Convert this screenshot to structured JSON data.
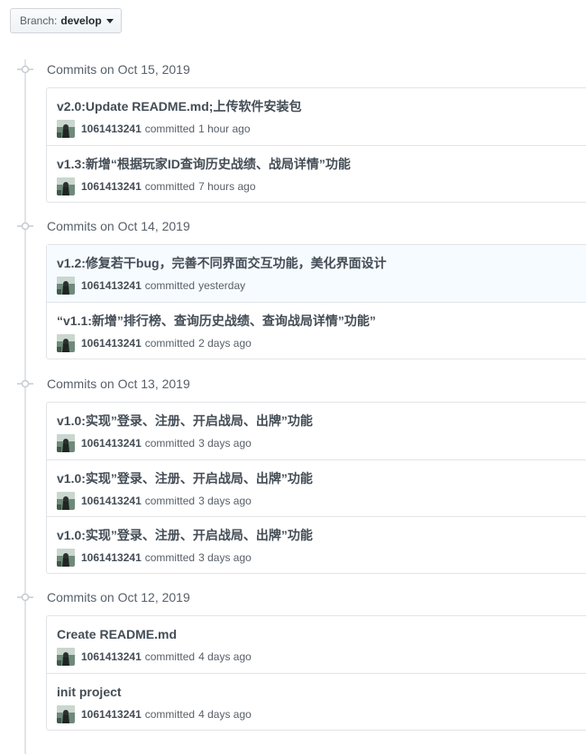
{
  "branch": {
    "prefix": "Branch:",
    "name": "develop"
  },
  "groups": [
    {
      "title": "Commits on Oct 15, 2019",
      "commits": [
        {
          "message": "v2.0:Update README.md;上传软件安装包",
          "author": "1061413241",
          "verb": "committed",
          "time": "1 hour ago"
        },
        {
          "message": "v1.3:新增“根据玩家ID查询历史战绩、战局详情”功能",
          "author": "1061413241",
          "verb": "committed",
          "time": "7 hours ago"
        }
      ]
    },
    {
      "title": "Commits on Oct 14, 2019",
      "commits": [
        {
          "message": "v1.2:修复若干bug，完善不同界面交互功能，美化界面设计",
          "author": "1061413241",
          "verb": "committed",
          "time": "yesterday"
        },
        {
          "message": "“v1.1:新增”排行榜、查询历史战绩、查询战局详情”功能”",
          "author": "1061413241",
          "verb": "committed",
          "time": "2 days ago"
        }
      ]
    },
    {
      "title": "Commits on Oct 13, 2019",
      "commits": [
        {
          "message": "v1.0:实现”登录、注册、开启战局、出牌”功能",
          "author": "1061413241",
          "verb": "committed",
          "time": "3 days ago"
        },
        {
          "message": "v1.0:实现”登录、注册、开启战局、出牌”功能",
          "author": "1061413241",
          "verb": "committed",
          "time": "3 days ago"
        },
        {
          "message": "v1.0:实现”登录、注册、开启战局、出牌”功能",
          "author": "1061413241",
          "verb": "committed",
          "time": "3 days ago"
        }
      ]
    },
    {
      "title": "Commits on Oct 12, 2019",
      "commits": [
        {
          "message": "Create README.md",
          "author": "1061413241",
          "verb": "committed",
          "time": "4 days ago"
        },
        {
          "message": "init project",
          "author": "1061413241",
          "verb": "committed",
          "time": "4 days ago"
        }
      ]
    }
  ],
  "icons": {
    "branch_caret": "caret-down-icon",
    "group_node": "git-commit-icon",
    "author_avatar": "avatar"
  },
  "colors": {
    "border": "#e1e4e8",
    "muted_text": "#586069",
    "title_text": "#444d56",
    "highlight_row": "#f6fbff"
  }
}
